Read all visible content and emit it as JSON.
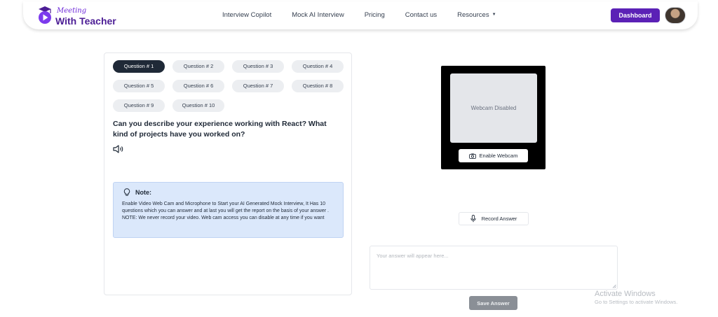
{
  "brand": {
    "name_top": "Meeting",
    "name_bottom": "With Teacher",
    "colors": {
      "primary": "#5b21b6",
      "logo_purple": "#6d28d9"
    }
  },
  "nav": {
    "items": [
      {
        "label": "Interview Copilot"
      },
      {
        "label": "Mock AI Interview"
      },
      {
        "label": "Pricing"
      },
      {
        "label": "Contact us"
      },
      {
        "label": "Resources",
        "dropdown": true
      }
    ],
    "dashboard_label": "Dashboard"
  },
  "questions": {
    "tabs": [
      {
        "label": "Question # 1",
        "active": true
      },
      {
        "label": "Question # 2"
      },
      {
        "label": "Question # 3"
      },
      {
        "label": "Question # 4"
      },
      {
        "label": "Question # 5"
      },
      {
        "label": "Question # 6"
      },
      {
        "label": "Question # 7"
      },
      {
        "label": "Question # 8"
      },
      {
        "label": "Question # 9"
      },
      {
        "label": "Question # 10"
      }
    ],
    "current_text": "Can you describe your experience working with React? What kind of projects have you worked on?"
  },
  "note": {
    "title": "Note:",
    "body": "Enable Video Web Cam and Microphone to Start your AI Generated Mock Interview, It Has 10 questions which you can answer and at last you will get the report on the basis of your answer . NOTE: We never record your video. Web cam access you can disable at any time if you want"
  },
  "webcam": {
    "status": "Webcam Disabled",
    "enable_label": "Enable Webcam"
  },
  "record": {
    "label": "Record Answer"
  },
  "answer": {
    "placeholder": "Your answer will appear here...",
    "value": ""
  },
  "save": {
    "label": "Save Answer"
  },
  "watermark": {
    "title": "Activate Windows",
    "subtitle": "Go to Settings to activate Windows."
  },
  "icons": [
    "logo-play-icon",
    "chevron-down-icon",
    "speaker-icon",
    "lightbulb-icon",
    "camera-icon",
    "microphone-icon",
    "resize-handle-icon"
  ]
}
